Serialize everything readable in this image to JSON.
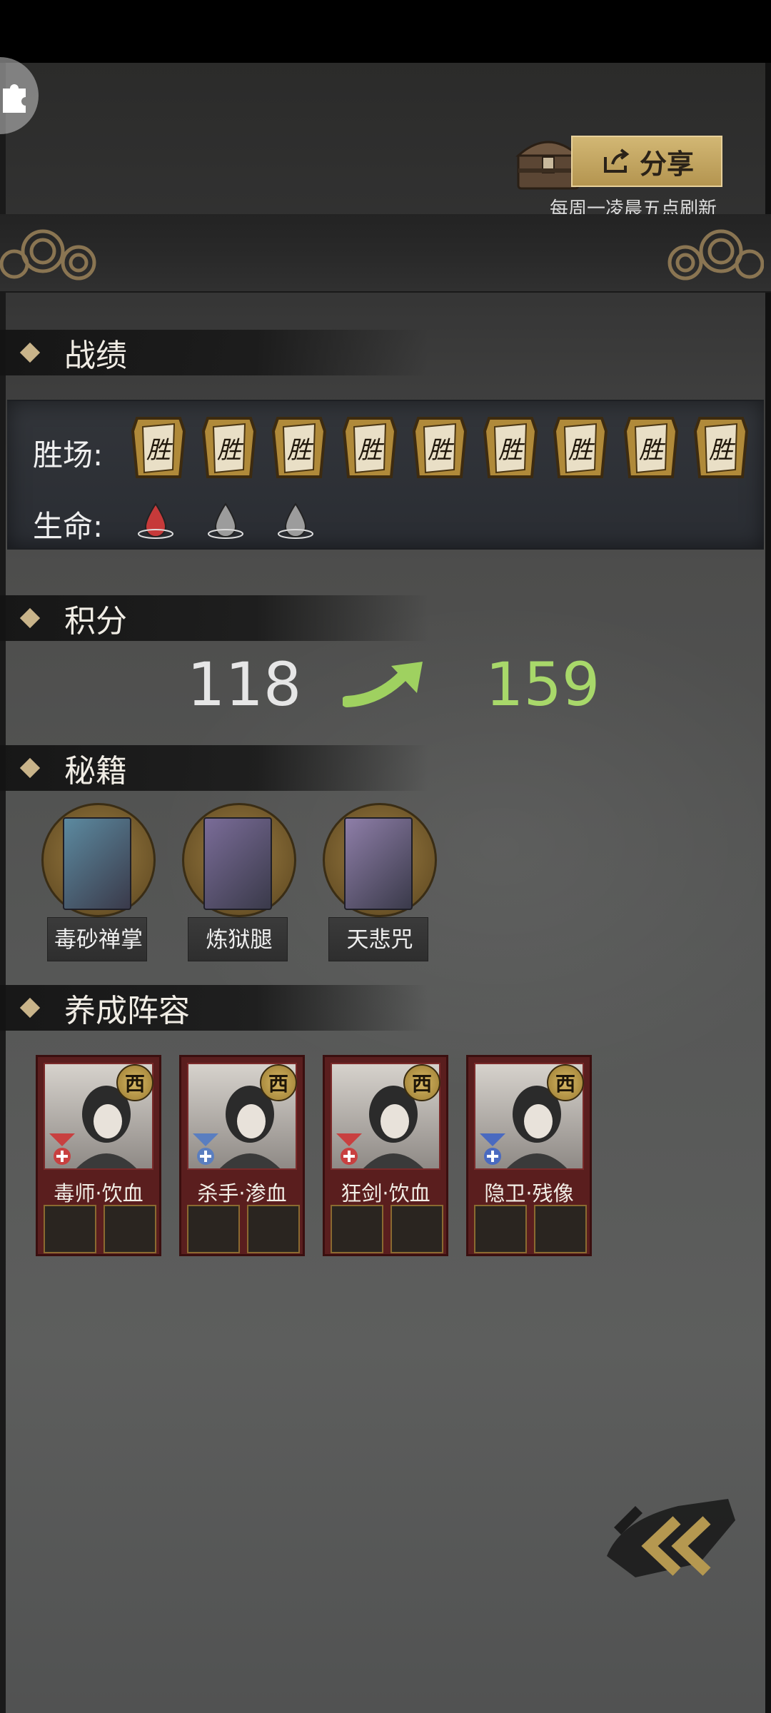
{
  "header": {
    "share_label": "分享",
    "refresh_note": "每周一凌晨五点刷新"
  },
  "sections": {
    "record": "战绩",
    "score": "积分",
    "secrets": "秘籍",
    "lineup": "养成阵容"
  },
  "record": {
    "wins_label": "胜场:",
    "lives_label": "生命:",
    "win_token_text": "胜",
    "wins_count": 9,
    "lives": [
      {
        "state": "full",
        "color": "#c63a3a"
      },
      {
        "state": "empty",
        "color": "#9c9c9c"
      },
      {
        "state": "empty",
        "color": "#9c9c9c"
      }
    ]
  },
  "score": {
    "before": "118",
    "after": "159"
  },
  "secrets": [
    {
      "name": "毒砂禅掌",
      "color": "#5c8aa0"
    },
    {
      "name": "炼狱腿",
      "color": "#7a6c98"
    },
    {
      "name": "天悲咒",
      "color": "#8e7ea8"
    }
  ],
  "lineup": [
    {
      "name": "毒师·饮血",
      "badge": "西",
      "role_color": "#c84040",
      "equip": [
        "tablet-icon",
        "amulet-icon"
      ]
    },
    {
      "name": "杀手·渗血",
      "badge": "西",
      "role_color": "#5a7ec0",
      "equip": [
        "ring-icon",
        "ring-icon"
      ]
    },
    {
      "name": "狂剑·饮血",
      "badge": "西",
      "role_color": "#c84040",
      "equip": [
        "pouch-icon",
        "bracelet-icon"
      ]
    },
    {
      "name": "隐卫·残像",
      "badge": "西",
      "role_color": "#4a6ac0",
      "equip": [
        "puzzle-icon",
        "bear-icon"
      ]
    }
  ]
}
